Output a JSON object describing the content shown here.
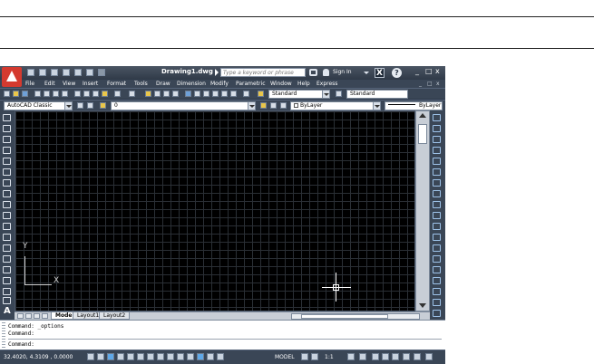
{
  "titlebar": {
    "doc_title": "Drawing1.dwg",
    "search_placeholder": "Type a keyword or phrase",
    "sign_in": "Sign In",
    "minimize": "_",
    "restore": "□",
    "close": "x"
  },
  "menu": {
    "items": [
      "File",
      "Edit",
      "View",
      "Insert",
      "Format",
      "Tools",
      "Draw",
      "Dimension",
      "Modify",
      "Parametric",
      "Window",
      "Help",
      "Express"
    ],
    "doc_minimize": "_",
    "doc_restore": "□",
    "doc_close": "x"
  },
  "toolbar1": {
    "text_style": "Standard",
    "dim_style": "Standard"
  },
  "toolbar2": {
    "workspace": "AutoCAD Classic",
    "layer": "0",
    "color": "ByLayer",
    "linetype": "ByLayer"
  },
  "canvas": {
    "ucs_y": "Y",
    "ucs_x": "X"
  },
  "tabs": {
    "items": [
      "Model",
      "Layout1",
      "Layout2"
    ],
    "active": "Model"
  },
  "command": {
    "history": [
      "Command: _options",
      "Command:"
    ],
    "prompt": "Command:"
  },
  "status": {
    "coordinates": "32.4020, 4.3109 , 0.0000",
    "model": "MODEL",
    "annotation_scale": "1:1"
  },
  "colors": {
    "app_frame": "#2b3747",
    "canvas_bg": "#000000",
    "brand_red": "#d43a2f"
  }
}
